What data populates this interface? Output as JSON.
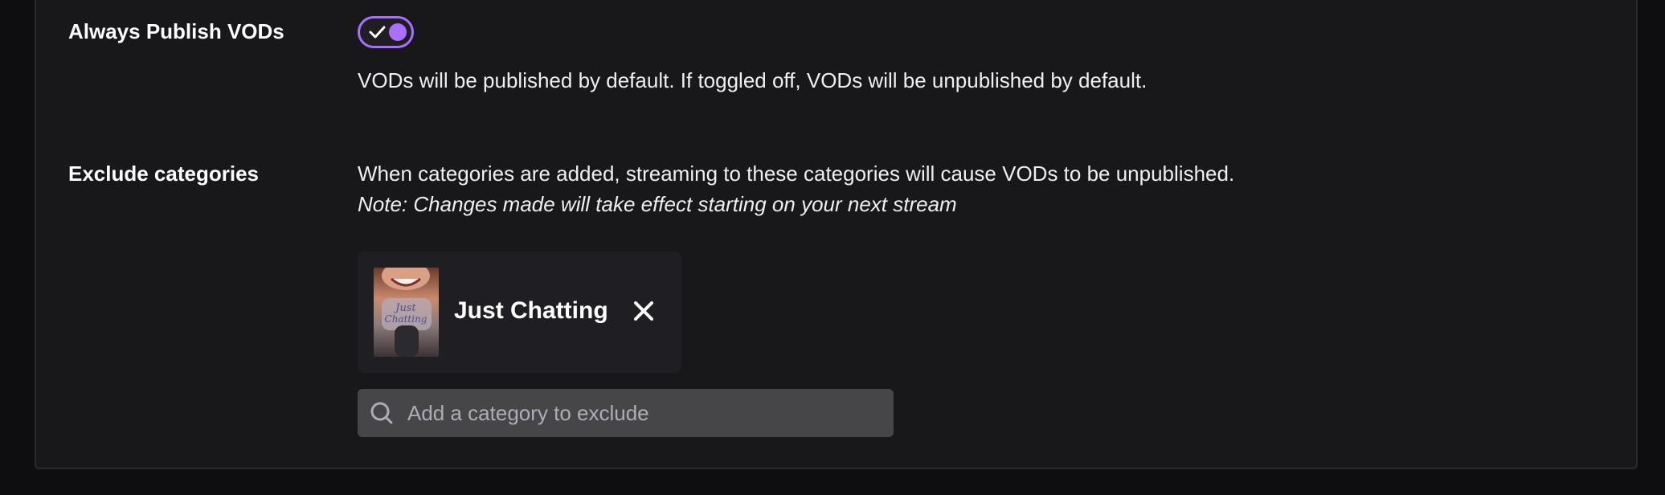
{
  "publish": {
    "label": "Always Publish VODs",
    "toggle_on": true,
    "description": "VODs will be published by default. If toggled off, VODs will be unpublished by default."
  },
  "exclude": {
    "label": "Exclude categories",
    "description": "When categories are added, streaming to these categories will cause VODs to be unpublished.",
    "note": "Note: Changes made will take effect starting on your next stream",
    "categories": [
      {
        "name": "Just Chatting",
        "thumbnail_icon": "just-chatting-boxart"
      }
    ],
    "search": {
      "placeholder": "Add a category to exclude",
      "value": ""
    }
  },
  "colors": {
    "accent": "#a970ff",
    "background": "#18181b",
    "input_bg": "#464649"
  }
}
